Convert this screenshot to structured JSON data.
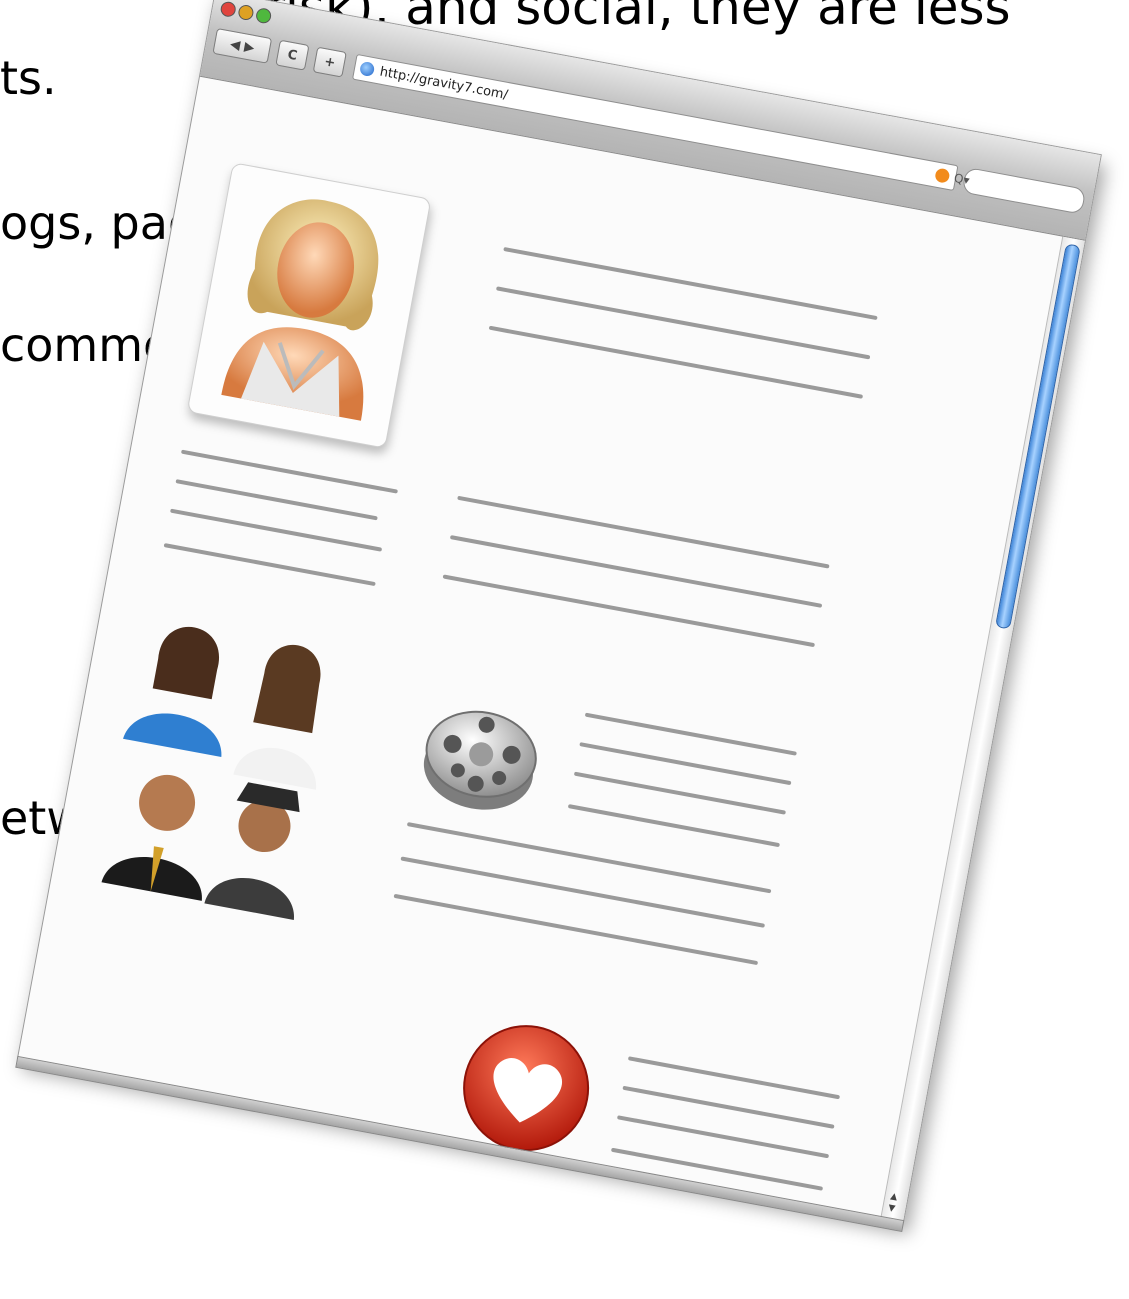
{
  "slide": {
    "line1": "o risk), and social, they are less",
    "line2": "ts.",
    "line3": "ogs, pages, videos, etc",
    "line4": "comments",
    "line5": "etworks"
  },
  "browser": {
    "url": "http://gravity7.com/",
    "search_placeholder": "Q▾",
    "back_label": "◀ ▶",
    "reload_label": "C",
    "add_label": "+",
    "scroll_up": "▲",
    "scroll_down": "▼"
  },
  "colors": {
    "scroll_thumb": "#4b90dd",
    "heart": "#d9301c",
    "rss": "#f28b1c"
  },
  "icons": [
    "avatar-woman-icon",
    "people-group-icon",
    "film-reel-icon",
    "heart-icon",
    "rss-icon",
    "globe-icon"
  ]
}
